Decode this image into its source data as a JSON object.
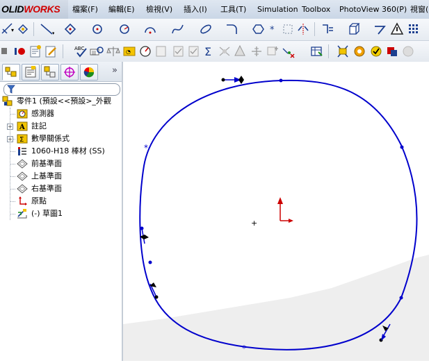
{
  "app": {
    "logo_prefix": "OLID",
    "logo_suffix": "WORKS"
  },
  "menu": {
    "items": [
      "檔案(F)",
      "編輯(E)",
      "檢視(V)",
      "插入(I)",
      "工具(T)",
      "Simulation",
      "Toolbox",
      "PhotoView 360(P)",
      "視窗("
    ]
  },
  "toolbar_sketch": {
    "icons": [
      "smart-dimension-icon",
      "line-icon",
      "rectangle-icon",
      "circle-icon",
      "arc-icon",
      "spline-icon",
      "ellipse-icon",
      "fillet-icon",
      "polygon-icon",
      "point-icon",
      "construction-icon",
      "mirror-icon",
      "offset-icon",
      "trim-icon",
      "display-delete-relations-icon",
      "grid-icon"
    ]
  },
  "toolbar_view": {
    "spell_label": "ABC",
    "icons": [
      "select-icon",
      "record-macro-icon",
      "new-sheet-icon",
      "edit-sheet-icon",
      "spell-check-icon",
      "measure-icon",
      "balance-icon",
      "sensor-icon",
      "performance-icon",
      "checkbox-icon",
      "checkbox-icon",
      "sum-icon",
      "mass-properties-icon",
      "section-icon",
      "relations-icon",
      "add-relation-icon",
      "check-sketch-icon",
      "render-icon",
      "appearance-icon",
      "photoview-icon",
      "color-icon",
      "settings-icon"
    ]
  },
  "panel": {
    "tabs": [
      "feature-manager-tab",
      "property-manager-tab",
      "configuration-manager-tab",
      "dimxpert-tab",
      "display-manager-tab"
    ],
    "collapse_label": "»",
    "tree": {
      "root_label": "零件1 (預設<<預設>_外觀",
      "items": [
        {
          "label": "感測器",
          "icon": "sensor-icon",
          "expandable": false
        },
        {
          "label": "註記",
          "icon": "annotation-icon",
          "expandable": true
        },
        {
          "label": "數學關係式",
          "icon": "equation-icon",
          "expandable": true
        },
        {
          "label": "1060-H18 棒材 (SS)",
          "icon": "material-icon",
          "expandable": false
        },
        {
          "label": "前基準面",
          "icon": "plane-icon",
          "expandable": false
        },
        {
          "label": "上基準面",
          "icon": "plane-icon",
          "expandable": false
        },
        {
          "label": "右基準面",
          "icon": "plane-icon",
          "expandable": false
        },
        {
          "label": "原點",
          "icon": "origin-icon",
          "expandable": false
        },
        {
          "label": "(-) 草圖1",
          "icon": "sketch-icon",
          "expandable": false
        }
      ]
    }
  },
  "canvas": {
    "spline_color": "#0000cc",
    "origin_x_color": "#cc0000",
    "origin_y_color": "#cc0000"
  }
}
